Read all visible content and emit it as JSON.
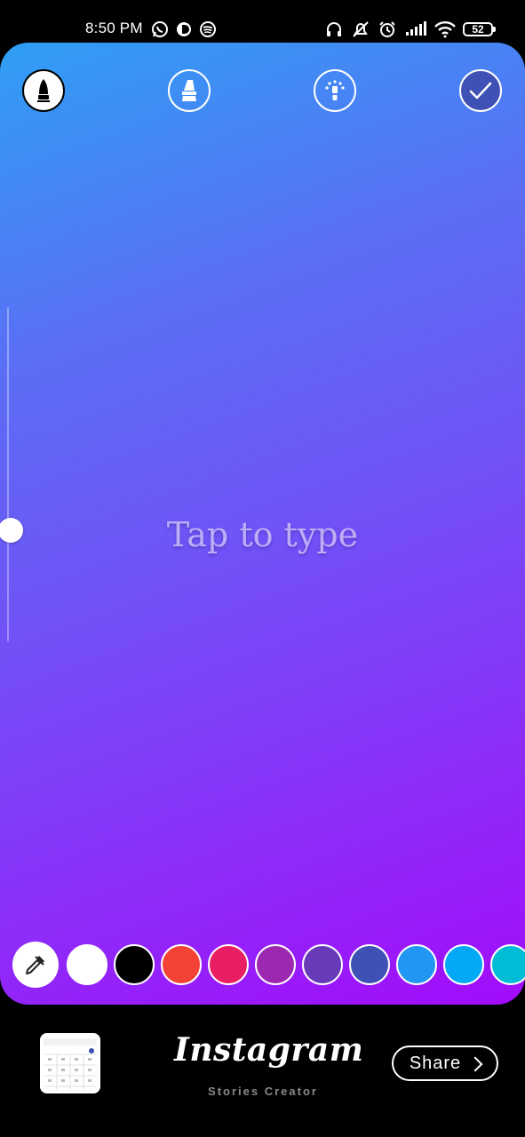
{
  "status_bar": {
    "time": "8:50 PM",
    "battery": "52",
    "icons_left": [
      "whatsapp-icon",
      "app-icon",
      "spotify-icon"
    ],
    "icons_right": [
      "headphones-icon",
      "mute-icon",
      "alarm-icon",
      "signal-icon",
      "wifi-icon",
      "battery-icon"
    ]
  },
  "toolbar": {
    "buttons": [
      "marker-icon",
      "brush-icon",
      "effects-icon",
      "done-check-icon"
    ]
  },
  "canvas": {
    "placeholder": "Tap to type",
    "gradient": [
      "#2f9ff4",
      "#6f54f6",
      "#a20bfb"
    ]
  },
  "palette": {
    "colors": [
      "#ffffff",
      "#000000",
      "#f44336",
      "#e91e63",
      "#9c27b0",
      "#673ab7",
      "#3f51b5",
      "#2196f3",
      "#03a9f4",
      "#00bcd4"
    ]
  },
  "footer": {
    "brand": "Instagram",
    "subtitle": "Stories Creator",
    "share_label": "Share"
  }
}
